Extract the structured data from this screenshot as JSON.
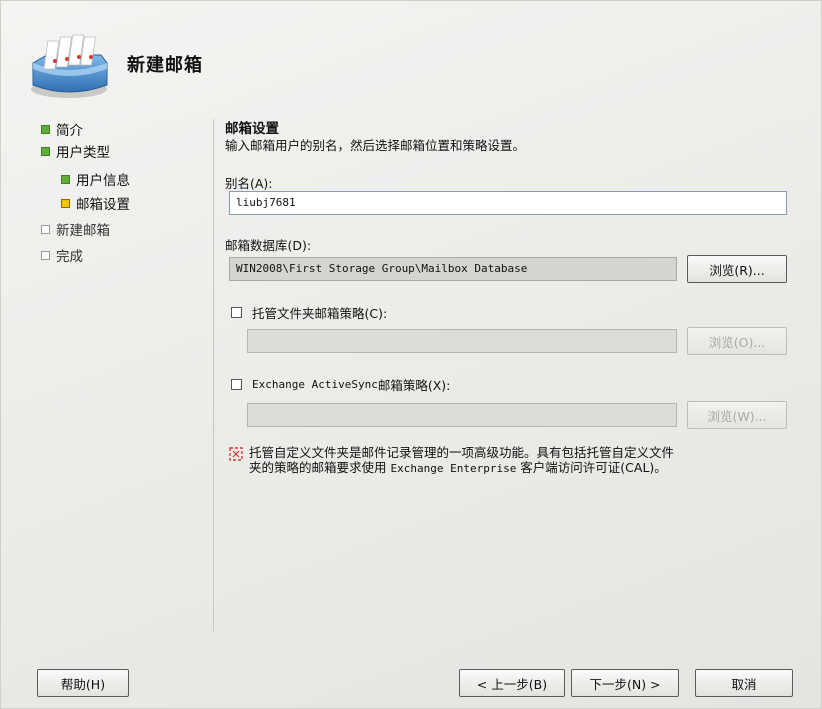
{
  "title": "新建邮箱",
  "steps": [
    {
      "label": "简介",
      "state": "done",
      "level": 0
    },
    {
      "label": "用户类型",
      "state": "done",
      "level": 0
    },
    {
      "label": "用户信息",
      "state": "done",
      "level": 1
    },
    {
      "label": "邮箱设置",
      "state": "current",
      "level": 1
    },
    {
      "label": "新建邮箱",
      "state": "pending",
      "level": 0
    },
    {
      "label": "完成",
      "state": "pending",
      "level": 0
    }
  ],
  "section": {
    "title": "邮箱设置",
    "description": "输入邮箱用户的别名，然后选择邮箱位置和策略设置。"
  },
  "alias": {
    "label": "别名(A):",
    "value": "liubj7681"
  },
  "database": {
    "label": "邮箱数据库(D):",
    "value": "WIN2008\\First Storage Group\\Mailbox Database",
    "browse_label": "浏览(R)..."
  },
  "managed_folder": {
    "label": "托管文件夹邮箱策略(C):",
    "checked": false,
    "value": "",
    "browse_label": "浏览(O)..."
  },
  "activesync": {
    "label_prefix": "Exchange ActiveSync",
    "label_suffix": " 邮箱策略(X):",
    "checked": false,
    "value": "",
    "browse_label": "浏览(W)..."
  },
  "info": {
    "text_line1": "托管自定义文件夹是邮件记录管理的一项高级功能。具有包括托管自定义文件",
    "text_line2_a": "夹的策略的邮箱要求使用 ",
    "text_line2_b": "Exchange Enterprise",
    "text_line2_c": " 客户端访问许可证(CAL)。"
  },
  "footer": {
    "help_label": "帮助(H)",
    "back_label": "< 上一步(B)",
    "next_label": "下一步(N) >",
    "cancel_label": "取消"
  },
  "colors": {
    "step_done": "#5fae3a",
    "step_current": "#f1c40f",
    "info_icon": "#d23b2f"
  }
}
